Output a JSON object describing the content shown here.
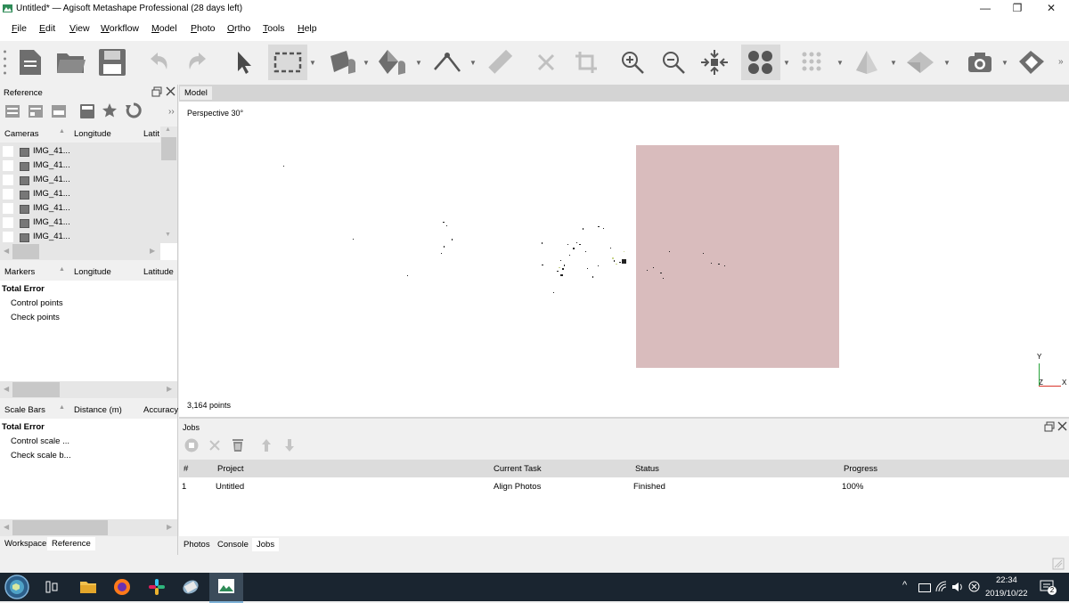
{
  "window": {
    "title": "Untitled* — Agisoft Metashape Professional (28 days left)",
    "minimize_glyph": "—",
    "restore_glyph": "❐",
    "close_glyph": "✕"
  },
  "menu": [
    "File",
    "Edit",
    "View",
    "Workflow",
    "Model",
    "Photo",
    "Ortho",
    "Tools",
    "Help"
  ],
  "toolbar": {
    "icons": [
      "new-document-icon",
      "open-folder-icon",
      "save-icon",
      "undo-icon",
      "redo-icon",
      "navigate-cursor-icon",
      "rectangle-selection-icon",
      "move-object-icon",
      "rotate-object-icon",
      "ruler-tool-icon",
      "measure-icon",
      "delete-icon",
      "crop-icon",
      "zoom-in-icon",
      "zoom-out-icon",
      "reset-view-icon",
      "point-cloud-icon",
      "dense-cloud-icon",
      "tiled-model-icon",
      "dem-icon",
      "camera-capture-icon",
      "shapes-icon"
    ],
    "overflow": "»"
  },
  "left_panel": {
    "title": "Reference",
    "overflow": "››",
    "cameras_table": {
      "columns": [
        "Cameras",
        "Longitude",
        "Latit"
      ],
      "rows": [
        "IMG_41...",
        "IMG_41...",
        "IMG_41...",
        "IMG_41...",
        "IMG_41...",
        "IMG_41...",
        "IMG_41..."
      ]
    },
    "markers_table": {
      "columns": [
        "Markers",
        "Longitude",
        "Latitude"
      ],
      "rows": [
        {
          "label": "Total Error",
          "bold": true
        },
        {
          "label": "Control points",
          "bold": false
        },
        {
          "label": "Check points",
          "bold": false
        }
      ]
    },
    "scalebars_table": {
      "columns": [
        "Scale Bars",
        "Distance (m)",
        "Accuracy"
      ],
      "rows": [
        {
          "label": "Total Error",
          "bold": true
        },
        {
          "label": "Control scale ...",
          "bold": false
        },
        {
          "label": "Check scale b...",
          "bold": false
        }
      ]
    },
    "tabs": [
      "Workspace",
      "Reference"
    ],
    "active_tab": "Reference"
  },
  "model_view": {
    "tab": "Model",
    "perspective": "Perspective 30°",
    "point_count": "3,164 points",
    "axis_y": "Y",
    "axis_z": "Z",
    "axis_x": "X",
    "region_color": "#d9bcbd"
  },
  "jobs": {
    "title": "Jobs",
    "columns": [
      "#",
      "Project",
      "Current Task",
      "Status",
      "Progress"
    ],
    "rows": [
      {
        "num": "1",
        "project": "Untitled",
        "task": "Align Photos",
        "status": "Finished",
        "progress": "100%"
      }
    ]
  },
  "bottom_tabs": [
    "Photos",
    "Console",
    "Jobs"
  ],
  "active_bottom_tab": "Jobs",
  "taskbar": {
    "time": "22:34",
    "date": "2019/10/22",
    "notification_count": "2",
    "tray_chevron": "^"
  }
}
